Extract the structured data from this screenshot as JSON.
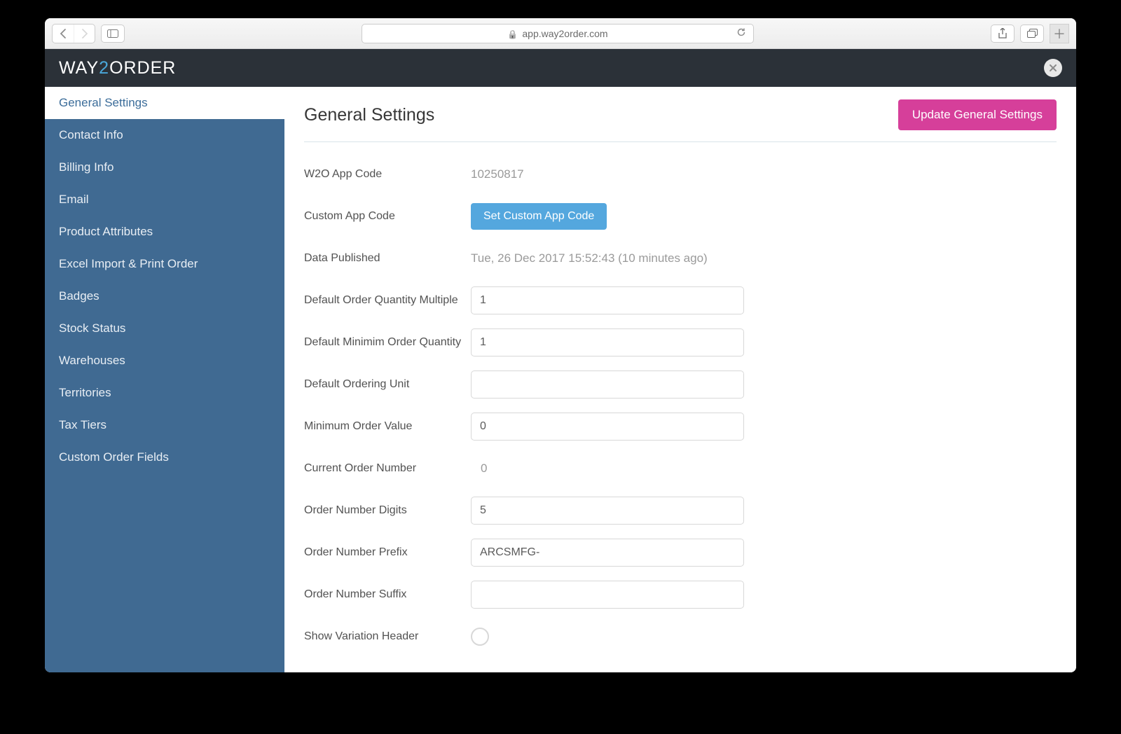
{
  "browser": {
    "url_host": "app.way2order.com"
  },
  "logo": {
    "part1": "WAY",
    "part2": "2",
    "part3": "ORDER"
  },
  "sidebar": {
    "items": [
      {
        "label": "General Settings",
        "active": true
      },
      {
        "label": "Contact Info",
        "active": false
      },
      {
        "label": "Billing Info",
        "active": false
      },
      {
        "label": "Email",
        "active": false
      },
      {
        "label": "Product Attributes",
        "active": false
      },
      {
        "label": "Excel Import & Print Order",
        "active": false
      },
      {
        "label": "Badges",
        "active": false
      },
      {
        "label": "Stock Status",
        "active": false
      },
      {
        "label": "Warehouses",
        "active": false
      },
      {
        "label": "Territories",
        "active": false
      },
      {
        "label": "Tax Tiers",
        "active": false
      },
      {
        "label": "Custom Order Fields",
        "active": false
      }
    ]
  },
  "page": {
    "title": "General Settings",
    "update_button": "Update General Settings"
  },
  "fields": {
    "w2o_app_code": {
      "label": "W2O App Code",
      "value": "10250817"
    },
    "custom_app_code": {
      "label": "Custom App Code",
      "button": "Set Custom App Code"
    },
    "data_published": {
      "label": "Data Published",
      "value": "Tue, 26 Dec 2017 15:52:43 (10 minutes ago)"
    },
    "default_qty_multiple": {
      "label": "Default Order Quantity Multiple",
      "value": "1"
    },
    "default_min_qty": {
      "label": "Default Minimim Order Quantity",
      "value": "1"
    },
    "default_unit": {
      "label": "Default Ordering Unit",
      "value": ""
    },
    "min_order_value": {
      "label": "Minimum Order Value",
      "value": "0"
    },
    "current_order_number": {
      "label": "Current Order Number",
      "value": "0"
    },
    "order_number_digits": {
      "label": "Order Number Digits",
      "value": "5"
    },
    "order_number_prefix": {
      "label": "Order Number Prefix",
      "value": "ARCSMFG-"
    },
    "order_number_suffix": {
      "label": "Order Number Suffix",
      "value": ""
    },
    "show_variation_header": {
      "label": "Show Variation Header"
    }
  }
}
